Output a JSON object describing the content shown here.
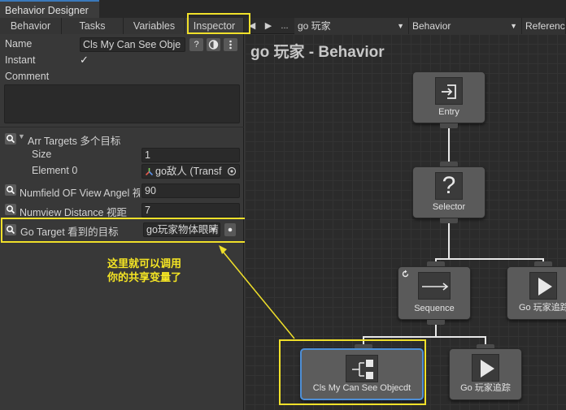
{
  "window": {
    "title": "Behavior Designer"
  },
  "tabs": [
    {
      "label": "Behavior"
    },
    {
      "label": "Tasks"
    },
    {
      "label": "Variables"
    },
    {
      "label": "Inspector",
      "active": true
    }
  ],
  "toolbar": {
    "nav_prev": "◀",
    "nav_next": "▶",
    "nav_more": "...",
    "object_dropdown": "go 玩家",
    "behavior_dropdown": "Behavior",
    "reference_dropdown": "Referenc"
  },
  "inspector": {
    "name_label": "Name",
    "name_value": "Cls   My Can See Obje",
    "instant_label": "Instant",
    "instant_checked": true,
    "check_mark": "✓",
    "comment_label": "Comment",
    "comment_value": "",
    "arr_targets_label": "Arr Targets 多个目标",
    "size_label": "Size",
    "size_value": "1",
    "element0_label": "Element 0",
    "element0_value": "go敌人 (Transf",
    "numfield_label": "Numfield OF View Angel 视",
    "numfield_value": "90",
    "numview_label": "Numview Distance 视距",
    "numview_value": "7",
    "gotarget_label": "Go Target 看到的目标",
    "gotarget_value": "go玩家物体眼睛",
    "help_btn": "?"
  },
  "annotation": {
    "line1": "这里就可以调用",
    "line2": "你的共享变量了"
  },
  "graph": {
    "title": "go 玩家 - Behavior",
    "nodes": {
      "entry": "Entry",
      "selector": "Selector",
      "sequence": "Sequence",
      "chase1": "Go 玩家追踪",
      "cls": "Cls   My Can See Objecdt",
      "chase2": "Go 玩家追踪"
    }
  },
  "colors": {
    "highlight": "#f0e02a",
    "selected_node_border": "#4e8fd6",
    "tab_accent": "#3a79bb"
  }
}
